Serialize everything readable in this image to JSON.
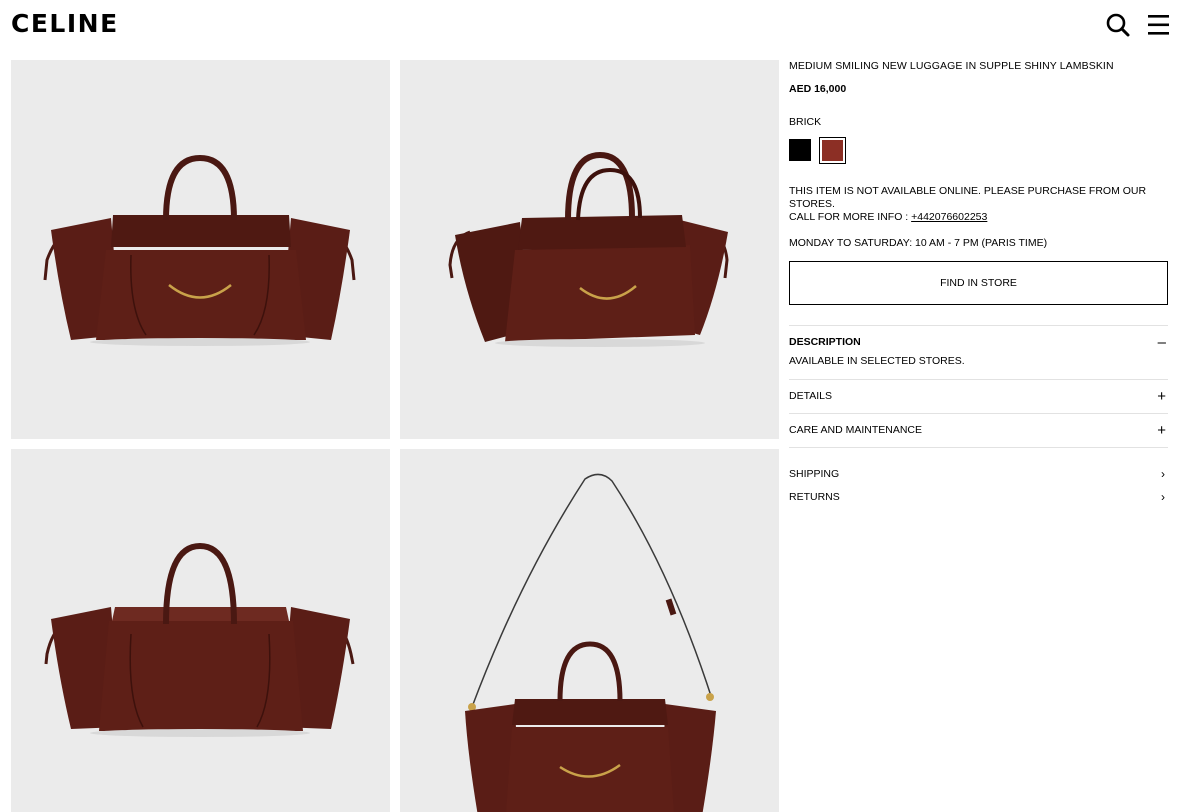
{
  "header": {
    "brand": "CELINE",
    "search_icon": "search-icon",
    "menu_icon": "hamburger-menu-icon"
  },
  "gallery": {
    "images": [
      {
        "view": "front"
      },
      {
        "view": "three-quarter"
      },
      {
        "view": "back"
      },
      {
        "view": "with-shoulder-strap"
      }
    ]
  },
  "product": {
    "name": "MEDIUM SMILING NEW LUGGAGE IN SUPPLE SHINY LAMBSKIN",
    "price": "AED 16,000",
    "color_label": "BRICK",
    "swatches": [
      {
        "color": "#000000",
        "selected": false
      },
      {
        "color": "#8c2f25",
        "selected": true
      }
    ],
    "availability": "THIS ITEM IS NOT AVAILABLE ONLINE. PLEASE PURCHASE FROM OUR STORES.",
    "call_label": "CALL FOR MORE INFO : ",
    "phone": "+442076602253",
    "hours": "MONDAY TO SATURDAY: 10 AM - 7 PM (PARIS TIME)",
    "find_in_store": "FIND IN STORE"
  },
  "accordion": {
    "description_title": "DESCRIPTION",
    "description_sign": "–",
    "description_body": "AVAILABLE IN SELECTED STORES.",
    "details_title": "DETAILS",
    "details_sign": "+",
    "care_title": "CARE AND MAINTENANCE",
    "care_sign": "+"
  },
  "links": {
    "shipping": "SHIPPING",
    "returns": "RETURNS",
    "chevron": "›"
  },
  "colors": {
    "bag": "#5a1d16",
    "bag_dark": "#3d110c",
    "bag_light": "#6e2a21",
    "tile_bg": "#ebebeb",
    "hardware": "#c9a24a"
  }
}
